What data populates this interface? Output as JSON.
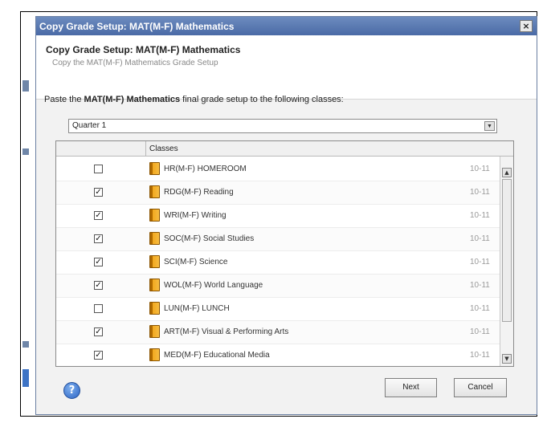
{
  "dialog": {
    "title": "Copy Grade Setup: MAT(M-F) Mathematics",
    "close_label": "×"
  },
  "header": {
    "title": "Copy Grade Setup: MAT(M-F) Mathematics",
    "subtitle": "Copy the MAT(M-F) Mathematics Grade Setup"
  },
  "instruction": {
    "prefix": "Paste the ",
    "course": "MAT(M-F) Mathematics",
    "suffix": " final grade setup to the following classes:"
  },
  "term_select": {
    "value": "Quarter 1",
    "arrow": "▼"
  },
  "grid": {
    "column_header": "Classes",
    "rows": [
      {
        "checked": false,
        "name": "HR(M-F) HOMEROOM",
        "grades": "10-11"
      },
      {
        "checked": true,
        "name": "RDG(M-F) Reading",
        "grades": "10-11"
      },
      {
        "checked": true,
        "name": "WRI(M-F) Writing",
        "grades": "10-11"
      },
      {
        "checked": true,
        "name": "SOC(M-F) Social Studies",
        "grades": "10-11"
      },
      {
        "checked": true,
        "name": "SCI(M-F) Science",
        "grades": "10-11"
      },
      {
        "checked": true,
        "name": "WOL(M-F) World Language",
        "grades": "10-11"
      },
      {
        "checked": false,
        "name": "LUN(M-F) LUNCH",
        "grades": "10-11"
      },
      {
        "checked": true,
        "name": "ART(M-F) Visual & Performing Arts",
        "grades": "10-11"
      },
      {
        "checked": true,
        "name": "MED(M-F) Educational Media",
        "grades": "10-11"
      }
    ],
    "scroll_up": "▲",
    "scroll_down": "▼"
  },
  "footer": {
    "help_label": "?",
    "next_label": "Next",
    "cancel_label": "Cancel"
  },
  "colors": {
    "title_bar": "#4a6aa6",
    "accent": "#2c64c4"
  },
  "icons": {
    "class": "book-icon",
    "help": "help-icon",
    "close": "close-icon"
  }
}
